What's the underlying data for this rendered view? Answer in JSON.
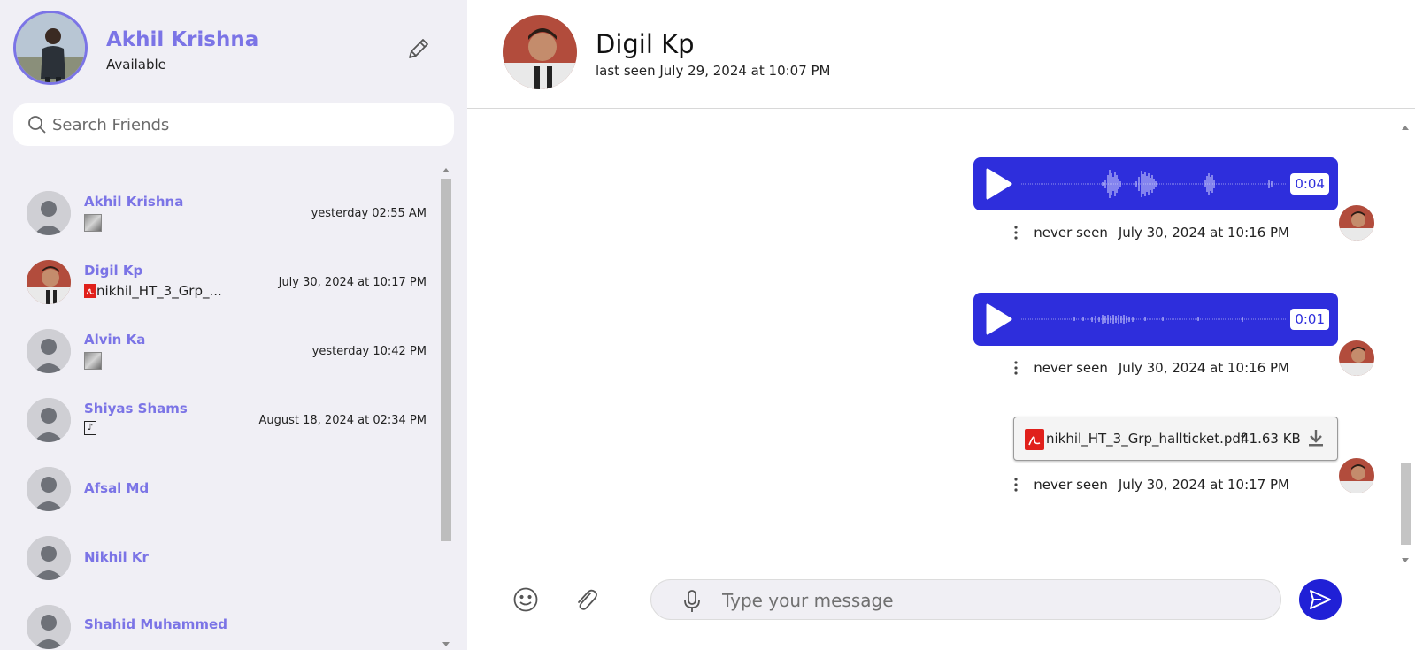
{
  "profile": {
    "name": "Akhil Krishna",
    "status": "Available"
  },
  "search": {
    "placeholder": "Search Friends"
  },
  "friends": [
    {
      "name": "Akhil Krishna",
      "time": "yesterday 02:55 AM",
      "preview_type": "image",
      "preview_text": ""
    },
    {
      "name": "Digil Kp",
      "time": "July 30, 2024 at 10:17 PM",
      "preview_type": "pdf",
      "preview_text": "nikhil_HT_3_Grp_..."
    },
    {
      "name": "Alvin Ka",
      "time": "yesterday 10:42 PM",
      "preview_type": "image",
      "preview_text": ""
    },
    {
      "name": "Shiyas Shams",
      "time": "August 18, 2024 at 02:34 PM",
      "preview_type": "audio",
      "preview_text": ""
    },
    {
      "name": "Afsal Md",
      "time": "",
      "preview_type": "none",
      "preview_text": ""
    },
    {
      "name": "Nikhil Kr",
      "time": "",
      "preview_type": "none",
      "preview_text": ""
    },
    {
      "name": "Shahid Muhammed",
      "time": "",
      "preview_type": "none",
      "preview_text": ""
    }
  ],
  "chat": {
    "name": "Digil Kp",
    "last_seen": "last seen July 29, 2024 at 10:07 PM",
    "messages": [
      {
        "type": "voice",
        "duration": "0:04",
        "seen": "never seen",
        "time": "July 30, 2024 at 10:16 PM"
      },
      {
        "type": "voice",
        "duration": "0:01",
        "seen": "never seen",
        "time": "July 30, 2024 at 10:16 PM"
      },
      {
        "type": "file",
        "file_name": "nikhil_HT_3_Grp_hallticket.pdf",
        "file_size": "41.63 KB",
        "seen": "never seen",
        "time": "July 30, 2024 at 10:17 PM"
      }
    ]
  },
  "composer": {
    "placeholder": "Type your message"
  },
  "icons": {
    "edit": "pencil-icon",
    "search": "search-icon",
    "play": "play-icon",
    "more": "kebab-icon",
    "pdf": "pdf-icon",
    "download": "download-icon",
    "emoji": "emoji-icon",
    "attach": "paperclip-icon",
    "mic": "mic-icon",
    "send": "send-icon"
  },
  "colors": {
    "accent": "#7b74e6",
    "voice_bubble": "#2e2edc",
    "send_button": "#2020d6",
    "sidebar_bg": "#f0eff5"
  }
}
